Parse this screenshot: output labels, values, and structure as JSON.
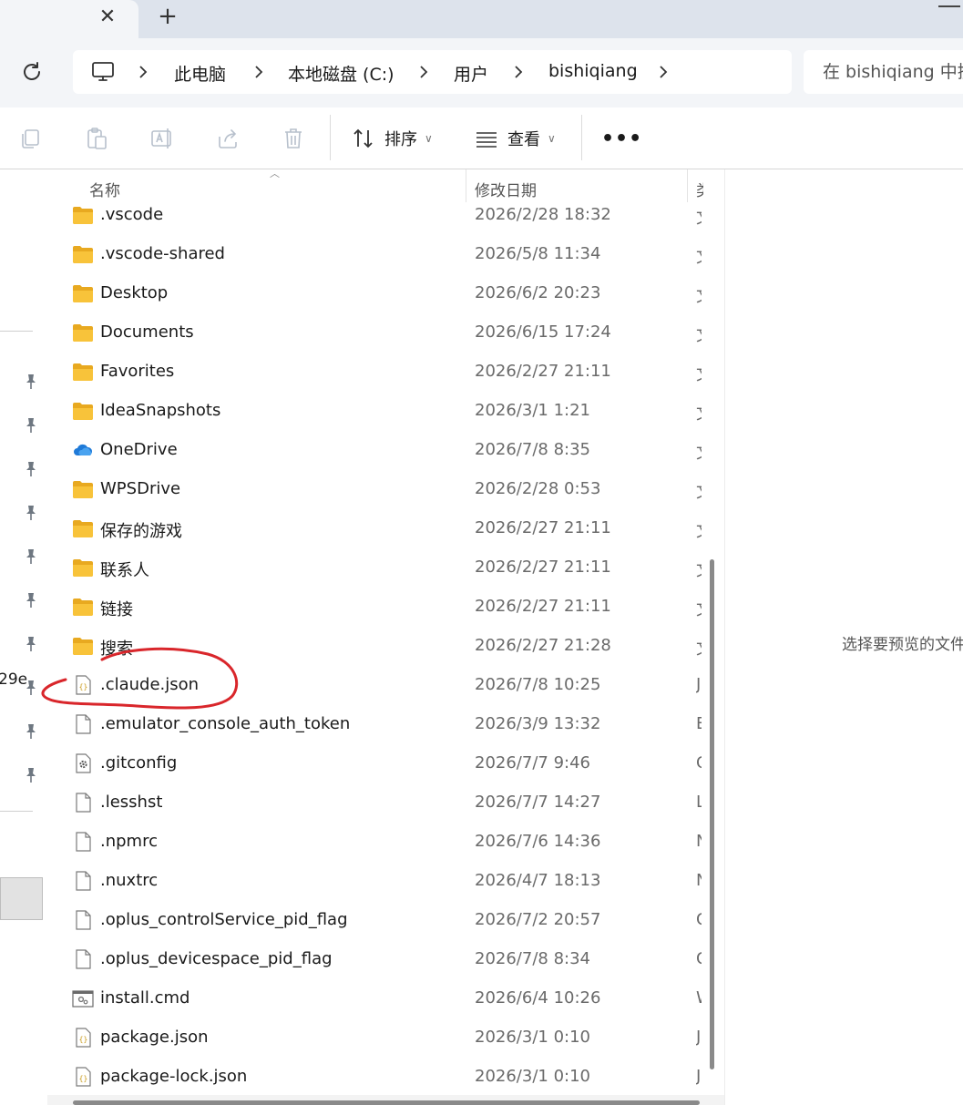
{
  "tabs": {
    "close_glyph": "✕",
    "new_tab_glyph": "+"
  },
  "address_bar": {
    "breadcrumbs": [
      "此电脑",
      "本地磁盘 (C:)",
      "用户",
      "bishiqiang"
    ],
    "search_placeholder": "在 bishiqiang 中搜"
  },
  "toolbar": {
    "sort_label": "排序",
    "view_label": "查看",
    "more_glyph": "•••",
    "icons": [
      "copy-icon",
      "paste-icon",
      "rename-icon",
      "share-icon",
      "delete-icon"
    ]
  },
  "nav_pane": {
    "truncated_text": "29e"
  },
  "file_list": {
    "columns": {
      "name": "名称",
      "modified": "修改日期",
      "type": "类"
    },
    "files": [
      {
        "name": ".vscode",
        "modified": "2026/2/28 18:32",
        "type": "文",
        "icon": "folder"
      },
      {
        "name": ".vscode-shared",
        "modified": "2026/5/8 11:34",
        "type": "文",
        "icon": "folder"
      },
      {
        "name": "Desktop",
        "modified": "2026/6/2 20:23",
        "type": "文",
        "icon": "folder"
      },
      {
        "name": "Documents",
        "modified": "2026/6/15 17:24",
        "type": "文",
        "icon": "folder"
      },
      {
        "name": "Favorites",
        "modified": "2026/2/27 21:11",
        "type": "文",
        "icon": "folder"
      },
      {
        "name": "IdeaSnapshots",
        "modified": "2026/3/1 1:21",
        "type": "文",
        "icon": "folder"
      },
      {
        "name": "OneDrive",
        "modified": "2026/7/8 8:35",
        "type": "文",
        "icon": "onedrive"
      },
      {
        "name": "WPSDrive",
        "modified": "2026/2/28 0:53",
        "type": "文",
        "icon": "folder"
      },
      {
        "name": "保存的游戏",
        "modified": "2026/2/27 21:11",
        "type": "文",
        "icon": "folder"
      },
      {
        "name": "联系人",
        "modified": "2026/2/27 21:11",
        "type": "文",
        "icon": "folder"
      },
      {
        "name": "链接",
        "modified": "2026/2/27 21:11",
        "type": "文",
        "icon": "folder"
      },
      {
        "name": "搜索",
        "modified": "2026/2/27 21:28",
        "type": "文",
        "icon": "folder"
      },
      {
        "name": ".claude.json",
        "modified": "2026/7/8 10:25",
        "type": "J",
        "icon": "json"
      },
      {
        "name": ".emulator_console_auth_token",
        "modified": "2026/3/9 13:32",
        "type": "E",
        "icon": "file"
      },
      {
        "name": ".gitconfig",
        "modified": "2026/7/7 9:46",
        "type": "G",
        "icon": "config"
      },
      {
        "name": ".lesshst",
        "modified": "2026/7/7 14:27",
        "type": "L",
        "icon": "file"
      },
      {
        "name": ".npmrc",
        "modified": "2026/7/6 14:36",
        "type": "N",
        "icon": "file"
      },
      {
        "name": ".nuxtrc",
        "modified": "2026/4/7 18:13",
        "type": "N",
        "icon": "file"
      },
      {
        "name": ".oplus_controlService_pid_flag",
        "modified": "2026/7/2 20:57",
        "type": "C",
        "icon": "file"
      },
      {
        "name": ".oplus_devicespace_pid_flag",
        "modified": "2026/7/8 8:34",
        "type": "C",
        "icon": "file"
      },
      {
        "name": "install.cmd",
        "modified": "2026/6/4 10:26",
        "type": "W",
        "icon": "cmd"
      },
      {
        "name": "package.json",
        "modified": "2026/3/1 0:10",
        "type": "J",
        "icon": "json"
      },
      {
        "name": "package-lock.json",
        "modified": "2026/3/1 0:10",
        "type": "J",
        "icon": "json"
      }
    ]
  },
  "preview_pane": {
    "message": "选择要预览的文件"
  },
  "colors": {
    "folder": "#f8c33a",
    "folder_dark": "#e8a920",
    "onedrive": "#1f7ad8",
    "annotation": "#d9262b",
    "json_brace": "#c89a1a"
  }
}
